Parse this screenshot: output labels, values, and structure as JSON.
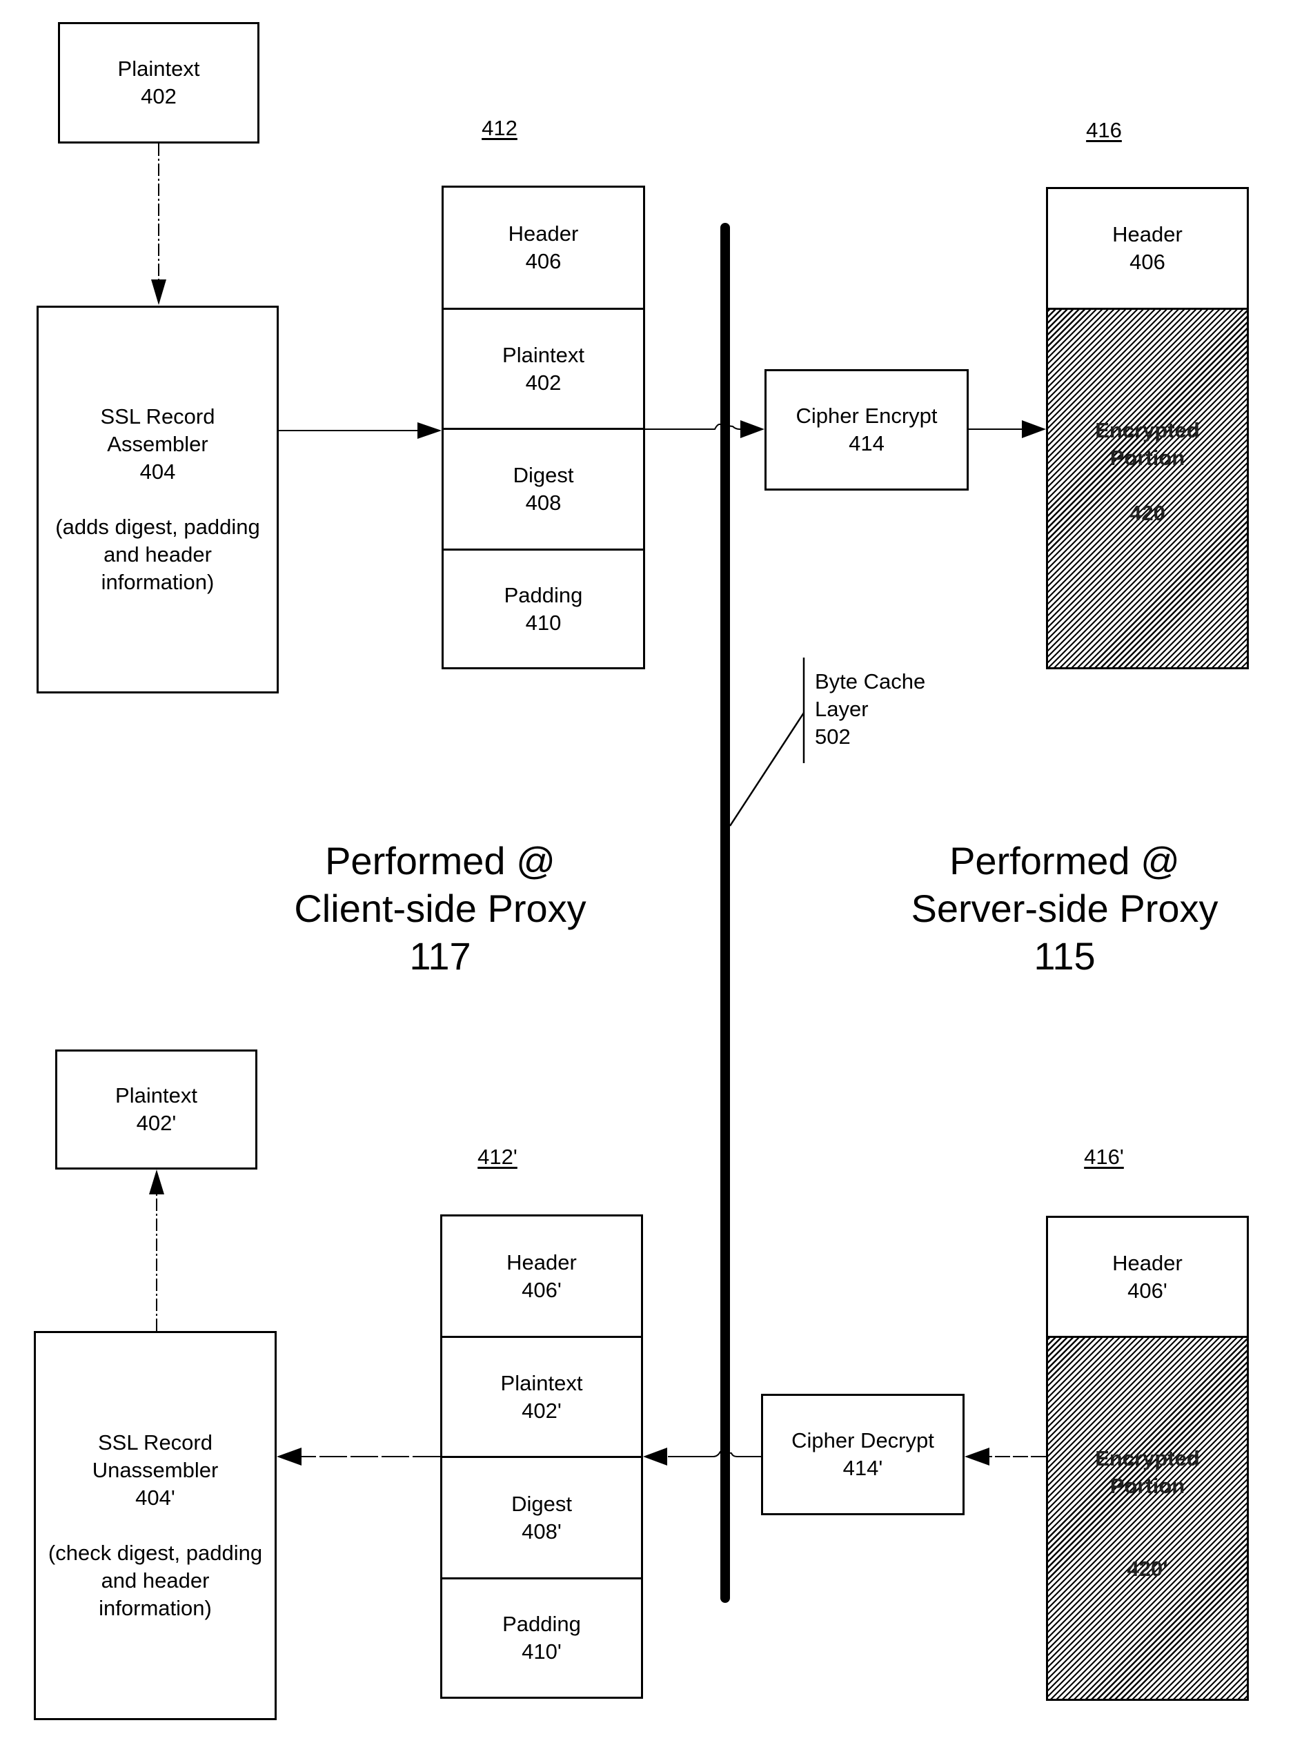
{
  "figure": {
    "client_side": {
      "plaintext_input": {
        "title": "Plaintext",
        "ref": "402"
      },
      "assembler": {
        "line1": "SSL Record",
        "line2": "Assembler",
        "ref": "404",
        "note1": "(adds digest, padding",
        "note2": "and header",
        "note3": "information)"
      },
      "record_412": {
        "label": "412",
        "cells": [
          {
            "title": "Header",
            "ref": "406"
          },
          {
            "title": "Plaintext",
            "ref": "402"
          },
          {
            "title": "Digest",
            "ref": "408"
          },
          {
            "title": "Padding",
            "ref": "410"
          }
        ]
      },
      "region_label": {
        "line1": "Performed @",
        "line2": "Client-side Proxy",
        "line3": "117"
      },
      "plaintext_output": {
        "title": "Plaintext",
        "ref": "402'"
      },
      "unassembler": {
        "line1": "SSL Record",
        "line2": "Unassembler",
        "ref": "404'",
        "note1": "(check digest, padding",
        "note2": "and header",
        "note3": "information)"
      },
      "record_412p": {
        "label": "412'",
        "cells": [
          {
            "title": "Header",
            "ref": "406'"
          },
          {
            "title": "Plaintext",
            "ref": "402'"
          },
          {
            "title": "Digest",
            "ref": "408'"
          },
          {
            "title": "Padding",
            "ref": "410'"
          }
        ]
      }
    },
    "server_side": {
      "cipher_encrypt": {
        "title": "Cipher Encrypt",
        "ref": "414"
      },
      "record_416": {
        "label": "416",
        "header": {
          "title": "Header",
          "ref": "406"
        },
        "encrypted": {
          "line1": "Encrypted",
          "line2": "Portion",
          "ref": "420"
        }
      },
      "region_label": {
        "line1": "Performed @",
        "line2": "Server-side Proxy",
        "line3": "115"
      },
      "cipher_decrypt": {
        "title": "Cipher Decrypt",
        "ref": "414'"
      },
      "record_416p": {
        "label": "416'",
        "header": {
          "title": "Header",
          "ref": "406'"
        },
        "encrypted": {
          "line1": "Encrypted",
          "line2": "Portion",
          "ref": "420'"
        }
      }
    },
    "byte_cache": {
      "line1": "Byte Cache",
      "line2": "Layer",
      "ref": "502"
    }
  }
}
